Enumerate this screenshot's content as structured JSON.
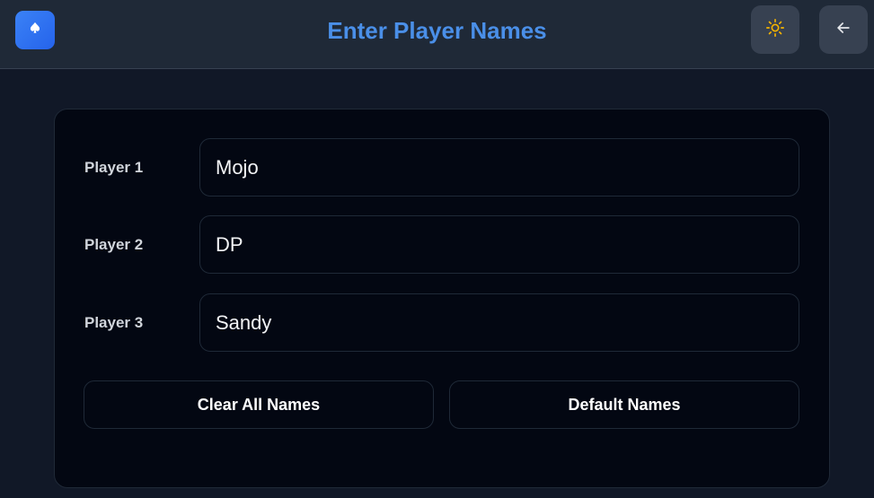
{
  "header": {
    "logo_icon": "spade-icon",
    "title": "Enter Player Names",
    "theme_toggle_icon": "sun-icon",
    "back_icon": "arrow-left-icon",
    "title_color": "#4a8fe8",
    "sun_color": "#f5b400"
  },
  "players": [
    {
      "label": "Player 1",
      "value": "Mojo"
    },
    {
      "label": "Player 2",
      "value": "DP"
    },
    {
      "label": "Player 3",
      "value": "Sandy"
    }
  ],
  "actions": {
    "clear_label": "Clear All Names",
    "default_label": "Default Names"
  }
}
